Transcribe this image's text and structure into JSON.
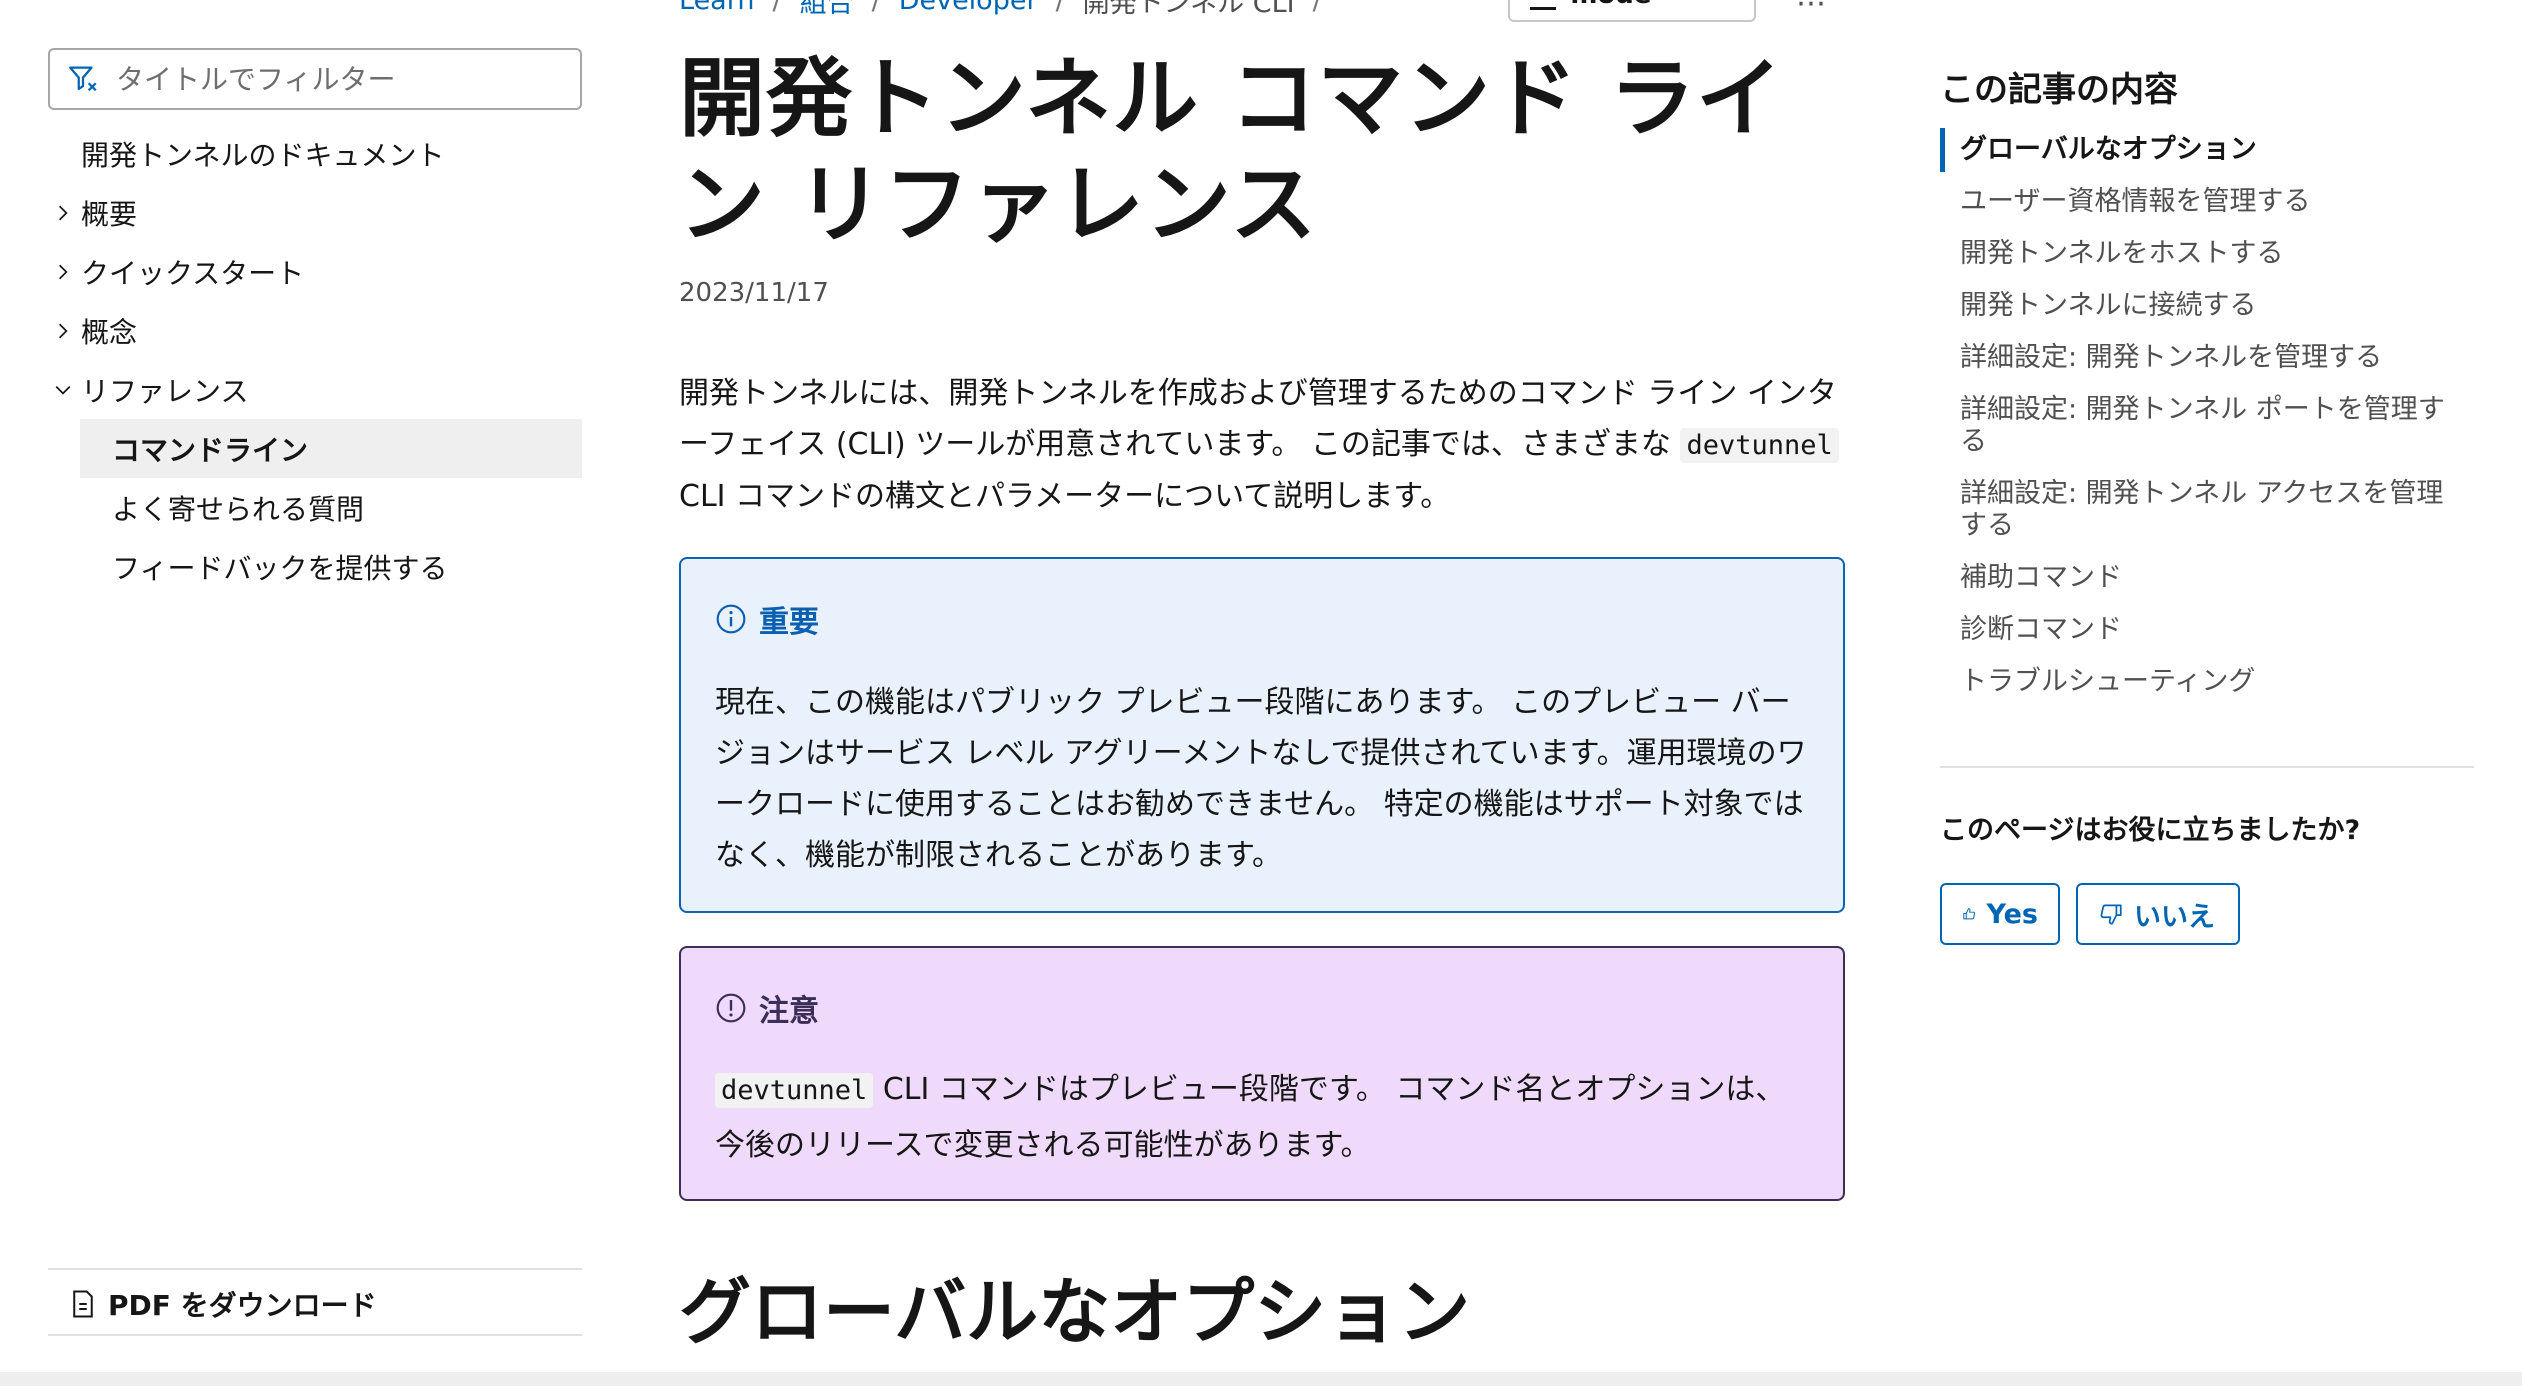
{
  "breadcrumb": {
    "items": [
      "Learn",
      "組合",
      "Developer",
      "開発トンネル CLI"
    ],
    "focus_mode_label": "Focus mode",
    "more_label": "⋯"
  },
  "sidebar": {
    "filter_placeholder": "タイトルでフィルター",
    "items": [
      {
        "label": "開発トンネルのドキュメント"
      },
      {
        "label": "概要"
      },
      {
        "label": "クイックスタート"
      },
      {
        "label": "概念"
      },
      {
        "label": "リファレンス"
      },
      {
        "label": "コマンドライン"
      },
      {
        "label": "よく寄せられる質問"
      },
      {
        "label": "フィードバックを提供する"
      }
    ],
    "download_pdf": "PDF をダウンロード"
  },
  "article": {
    "title": "開発トンネル コマンド ライン リファレンス",
    "date": "2023/11/17",
    "intro_part1": "開発トンネルには、開発トンネルを作成および管理するためのコマンド ライン インターフェイス (CLI) ツールが用意されています。 この記事では、さまざまな ",
    "intro_code": "devtunnel",
    "intro_part2": " CLI コマンドの構文とパラメーターについて説明します。",
    "important": {
      "title": "重要",
      "body": "現在、この機能はパブリック プレビュー段階にあります。 このプレビュー バージョンはサービス レベル アグリーメントなしで提供されています。運用環境のワークロードに使用することはお勧めできません。 特定の機能はサポート対象ではなく、機能が制限されることがあります。"
    },
    "caution": {
      "title": "注意",
      "code": "devtunnel",
      "body": " CLI コマンドはプレビュー段階です。 コマンド名とオプションは、今後のリリースで変更される可能性があります。"
    },
    "section_heading": "グローバルなオプション"
  },
  "rail": {
    "heading": "この記事の内容",
    "items": [
      "グローバルなオプション",
      "ユーザー資格情報を管理する",
      "開発トンネルをホストする",
      "開発トンネルに接続する",
      "詳細設定: 開発トンネルを管理する",
      "詳細設定: 開発トンネル ポートを管理する",
      "詳細設定: 開発トンネル アクセスを管理する",
      "補助コマンド",
      "診断コマンド",
      "トラブルシューティング"
    ],
    "feedback_question": "このページはお役に立ちましたか?",
    "yes_label": "Yes",
    "no_label": "いいえ"
  },
  "colors": {
    "accent": "#0065b3",
    "important_bg": "#e8f1fc",
    "important_border": "#0d63b5",
    "caution_bg": "#efdafb",
    "caution_border": "#3b2e58"
  }
}
